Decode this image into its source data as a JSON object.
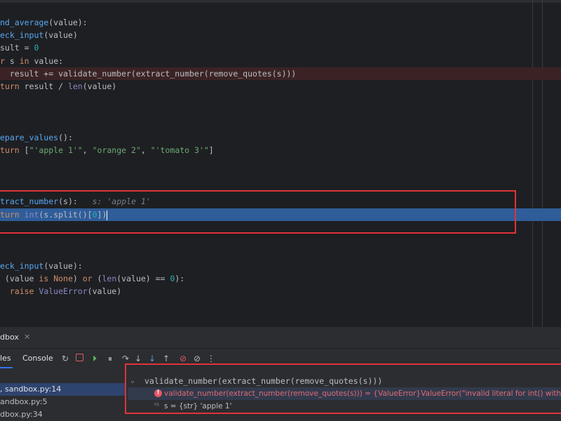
{
  "editor": {
    "code": {
      "l1": {
        "fn": "nd_average",
        "rest": "(value):"
      },
      "l2": {
        "fn": "eck_input",
        "rest": "(value)"
      },
      "l3": {
        "a": "sult = ",
        "num": "0"
      },
      "l4": {
        "kw": "r",
        "a": " s ",
        "kw2": "in",
        "b": " value:"
      },
      "l5": {
        "a": "  result += validate_number(extract_number(remove_quotes(s)))"
      },
      "l6": {
        "kw": "turn",
        "a": " result / ",
        "builtin": "len",
        "b": "(value)"
      },
      "l7": {
        "fn": "epare_values",
        "rest": "():"
      },
      "l8": {
        "kw": "turn",
        "a": " [",
        "s1": "\"'apple 1'\"",
        "c1": ", ",
        "s2": "\"orange 2\"",
        "c2": ", ",
        "s3": "\"'tomato 3'\"",
        "b": "]"
      },
      "l9": {
        "fn": "tract_number",
        "rest": "(s):",
        "hint": "s: 'apple 1'"
      },
      "l10": {
        "kw": "turn",
        "a": " ",
        "builtin": "int",
        "b": "(s.split()[",
        "num": "0",
        "c": "])"
      },
      "l11": {
        "fn": "eck_input",
        "rest": "(value):"
      },
      "l12": {
        "a": " (value ",
        "kw": "is",
        "b": " ",
        "kw2": "None",
        "c": ") ",
        "kw3": "or",
        "d": " (",
        "builtin": "len",
        "e": "(value) == ",
        "num": "0",
        "f": "):"
      },
      "l13": {
        "kw": "  raise",
        "a": " ",
        "builtin": "ValueError",
        "b": "(value)"
      }
    }
  },
  "tool_window": {
    "run_tab": "dbox",
    "tabs": {
      "frames": "les",
      "console": "Console"
    },
    "frames": [
      ", sandbox.py:14",
      "andbox.py:5",
      "dbox.py:34"
    ],
    "watch_expr": "validate_number(extract_number(remove_quotes(s)))",
    "error_text": "validate_number(extract_number(remove_quotes(s))) = {ValueError}ValueError(\"invalid literal for int() with base",
    "var_s": "s = {str} 'apple 1'"
  },
  "colors": {
    "accent": "#3574f0",
    "error": "#e0333a",
    "exec_line": "#2f5d99"
  }
}
